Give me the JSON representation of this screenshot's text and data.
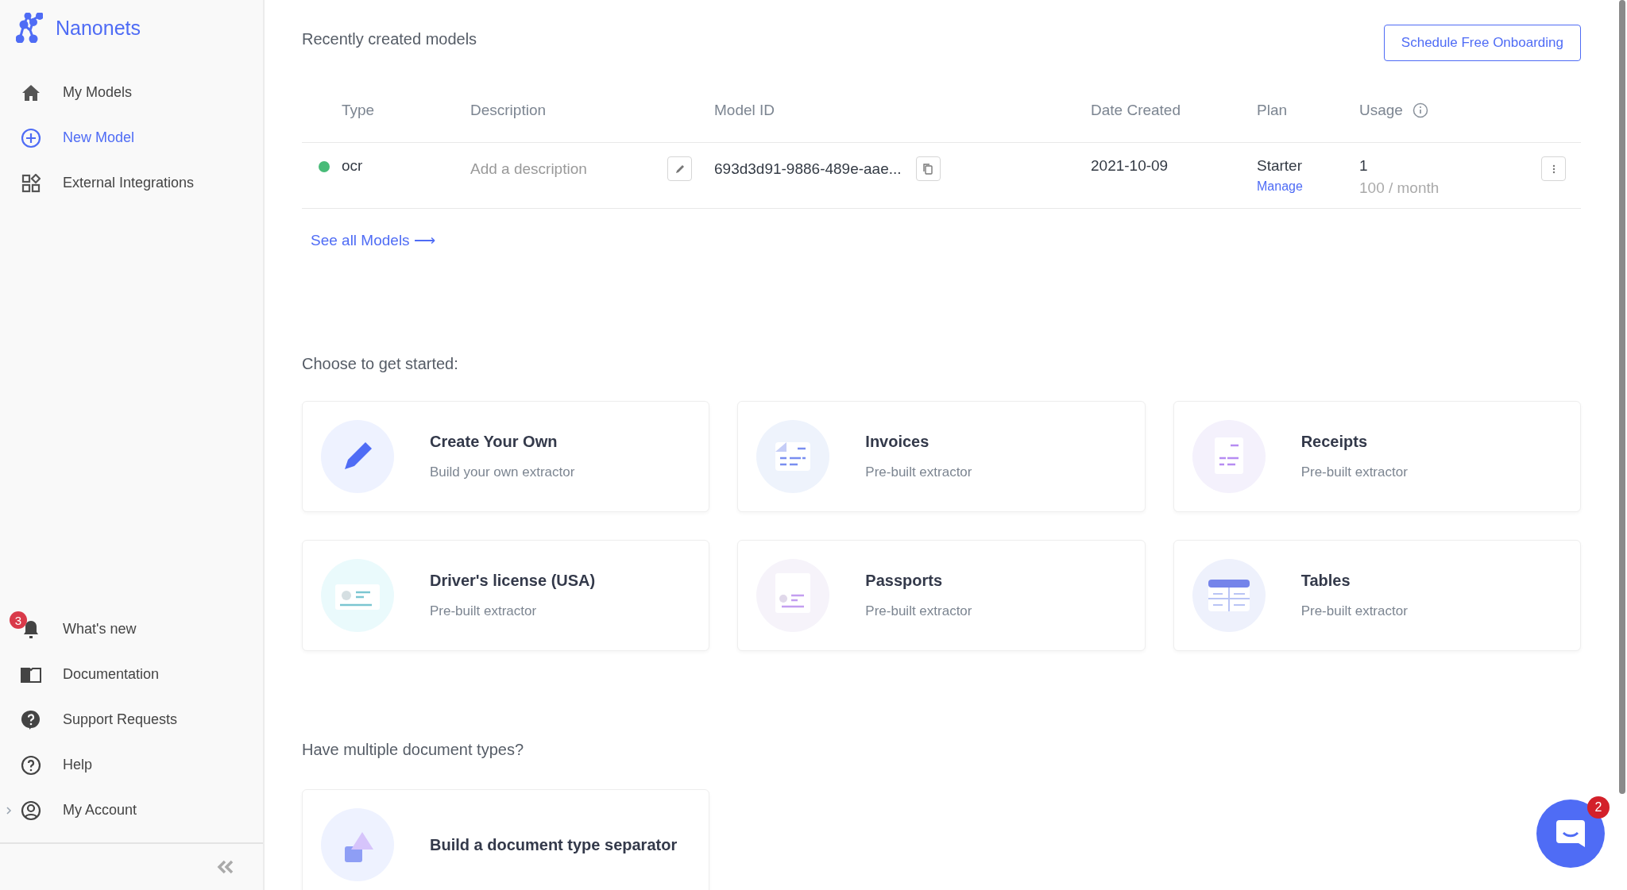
{
  "sidebar": {
    "brand": "Nanonets",
    "top_items": [
      {
        "label": "My Models",
        "selected": false
      },
      {
        "label": "New Model",
        "selected": true
      },
      {
        "label": "External Integrations",
        "selected": false
      }
    ],
    "bottom_items": [
      {
        "label": "What's new",
        "badge": "3"
      },
      {
        "label": "Documentation"
      },
      {
        "label": "Support Requests"
      },
      {
        "label": "Help"
      },
      {
        "label": "My Account",
        "expanded": false
      }
    ]
  },
  "recent": {
    "title": "Recently created models",
    "action": "Schedule Free Onboarding",
    "columns": [
      "Type",
      "Description",
      "Model ID",
      "Date Created",
      "Plan",
      "Usage"
    ],
    "rows": [
      {
        "color": "#48bb78",
        "type": "ocr",
        "description_placeholder": "Add a description",
        "model_id": "693d3d91-9886-489e-aae...",
        "date": "2021-10-09",
        "plan": "Starter",
        "plan_link": "Manage",
        "usage": "1",
        "usage_limit": "100 / month"
      }
    ],
    "see_all": "See all Models ⟶"
  },
  "get_started": {
    "title": "Choose to get started:",
    "cards": [
      {
        "title": "Create Your Own",
        "subtitle": "Build your own extractor"
      },
      {
        "title": "Invoices",
        "subtitle": "Pre-built extractor"
      },
      {
        "title": "Receipts",
        "subtitle": "Pre-built extractor"
      },
      {
        "title": "Driver's license (USA)",
        "subtitle": "Pre-built extractor"
      },
      {
        "title": "Passports",
        "subtitle": "Pre-built extractor"
      },
      {
        "title": "Tables",
        "subtitle": "Pre-built extractor"
      }
    ]
  },
  "multiple": {
    "title": "Have multiple document types?",
    "cards": [
      {
        "title": "Build a document type separator"
      }
    ]
  },
  "chat": {
    "badge": "2"
  }
}
